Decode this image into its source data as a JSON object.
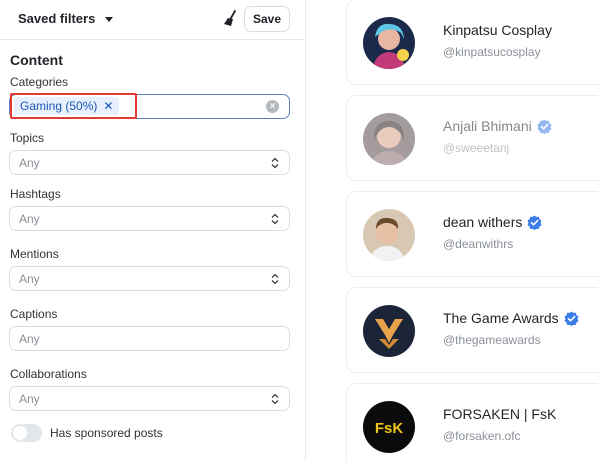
{
  "header": {
    "saved_filters_label": "Saved filters",
    "save_label": "Save"
  },
  "content": {
    "title": "Content",
    "categories": {
      "label": "Categories",
      "chip": "Gaming (50%)"
    },
    "topics": {
      "label": "Topics",
      "placeholder": "Any"
    },
    "hashtags": {
      "label": "Hashtags",
      "placeholder": "Any"
    },
    "mentions": {
      "label": "Mentions",
      "placeholder": "Any"
    },
    "captions": {
      "label": "Captions",
      "placeholder": "Any"
    },
    "collaborations": {
      "label": "Collaborations",
      "placeholder": "Any"
    },
    "sponsored": {
      "label": "Has sponsored posts",
      "enabled": false
    }
  },
  "creators": [
    {
      "name": "Kinpatsu Cosplay",
      "handle": "@kinpatsucosplay",
      "verified": false
    },
    {
      "name": "Anjali Bhimani",
      "handle": "@sweeetanj",
      "verified": true
    },
    {
      "name": "dean withers",
      "handle": "@deanwithrs",
      "verified": true
    },
    {
      "name": "The Game Awards",
      "handle": "@thegameawards",
      "verified": true
    },
    {
      "name": "FORSAKEN | FsK",
      "handle": "@forsaken.ofc",
      "verified": false,
      "avatar_text": "FsK"
    }
  ],
  "colors": {
    "accent": "#1a56b8",
    "chip_bg": "#e8f0fe",
    "highlight": "#e53935",
    "verified": "#3d7de8"
  },
  "icons": [
    "chevron-down-icon",
    "broom-icon",
    "clear-icon",
    "sort-icon",
    "verified-icon"
  ]
}
